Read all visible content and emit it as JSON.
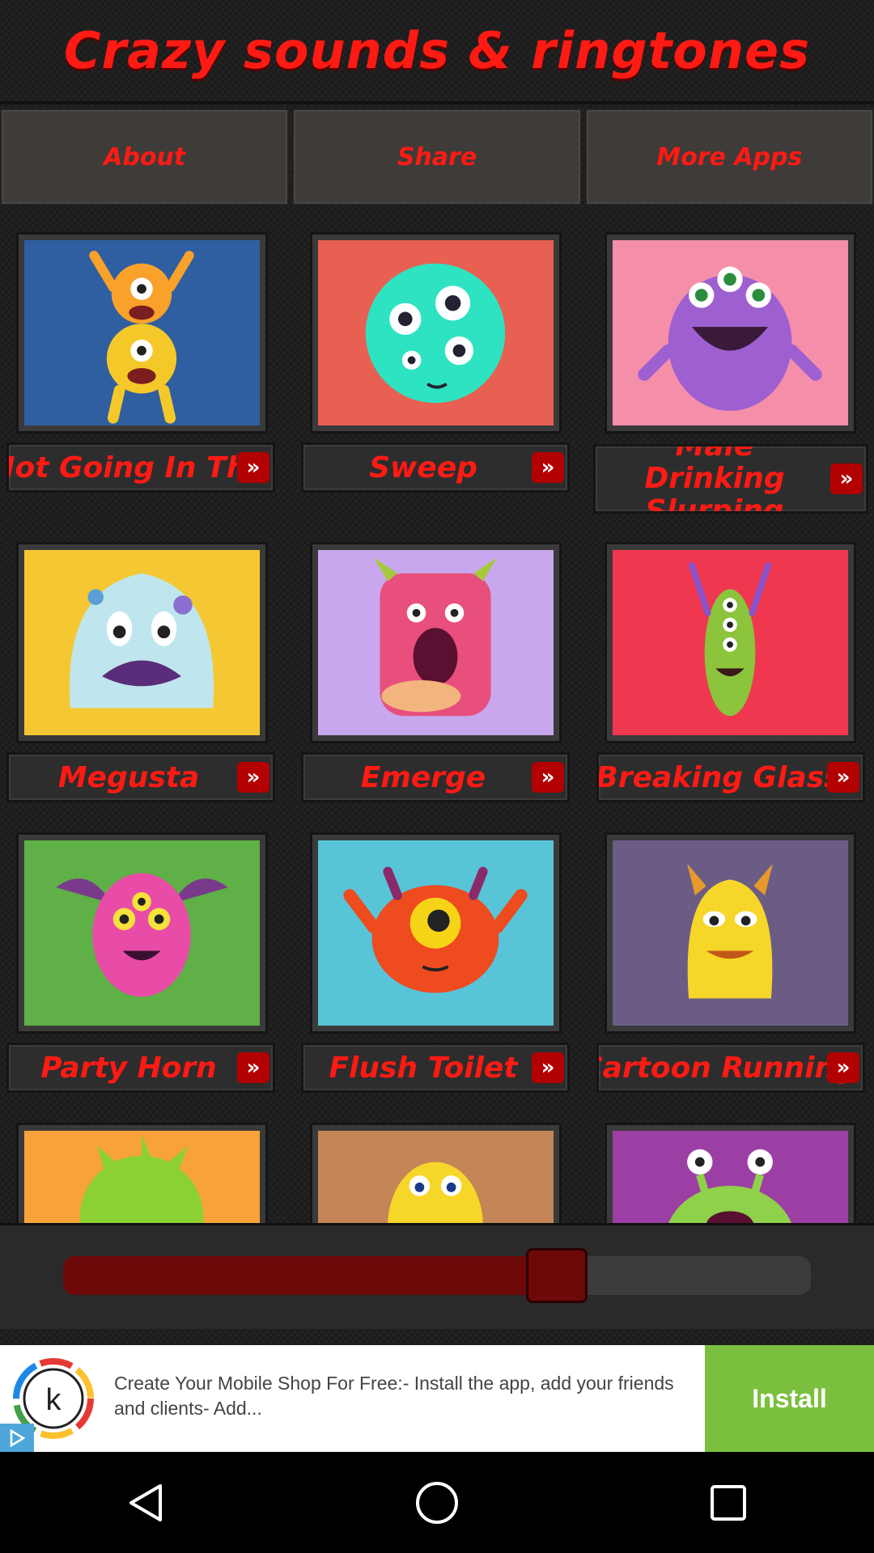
{
  "app": {
    "title": "Crazy sounds & ringtones"
  },
  "top_nav": [
    {
      "label": "About"
    },
    {
      "label": "Share"
    },
    {
      "label": "More Apps"
    }
  ],
  "sounds": [
    {
      "label": "Not Going In The",
      "bg": "#2f5fa0"
    },
    {
      "label": "Sweep",
      "bg": "#e86052"
    },
    {
      "label": "Male Drinking Slurping",
      "bg": "#f58fa9"
    },
    {
      "label": "Megusta",
      "bg": "#f5c833"
    },
    {
      "label": "Emerge",
      "bg": "#c9a7ef"
    },
    {
      "label": "Breaking Glass",
      "bg": "#ef3750"
    },
    {
      "label": "Party Horn",
      "bg": "#5fb046"
    },
    {
      "label": "Flush Toilet",
      "bg": "#58c4d8"
    },
    {
      "label": "Cartoon Running",
      "bg": "#6b5c86"
    },
    {
      "label": "",
      "bg": "#f7a33a"
    },
    {
      "label": "",
      "bg": "#c48656"
    },
    {
      "label": "",
      "bg": "#9c3fa5"
    }
  ],
  "player": {
    "progress_fraction": 0.66
  },
  "ad": {
    "text": "Create Your Mobile Shop For Free:- Install the app, add your friends and clients- Add...",
    "cta": "Install",
    "logo_letter": "k"
  },
  "navbar": [
    {
      "icon": "back-triangle-icon"
    },
    {
      "icon": "home-circle-icon"
    },
    {
      "icon": "recents-square-icon"
    }
  ]
}
